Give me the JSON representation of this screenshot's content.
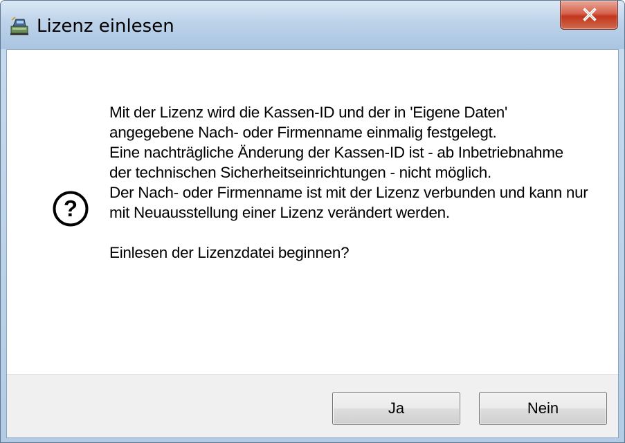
{
  "window": {
    "title": "Lizenz einlesen",
    "app_icon": "cash-register-icon",
    "close_icon": "close-icon"
  },
  "dialog": {
    "icon": "question-icon",
    "message_lines": [
      "Mit der Lizenz wird die Kassen-ID und der in 'Eigene Daten'",
      "angegebene Nach- oder Firmenname einmalig festgelegt.",
      "Eine nachträgliche Änderung der Kassen-ID ist - ab Inbetriebnahme",
      "der technischen Sicherheitseinrichtungen - nicht möglich.",
      "Der Nach- oder Firmenname ist mit der Lizenz verbunden und kann nur",
      "mit Neuausstellung einer Lizenz verändert werden.",
      "",
      "Einlesen der Lizenzdatei beginnen?"
    ]
  },
  "buttons": {
    "yes_label": "Ja",
    "no_label": "Nein"
  },
  "colors": {
    "titlebar": "#bcd2e9",
    "close_button": "#c2361c",
    "footer": "#f0f0f0"
  }
}
